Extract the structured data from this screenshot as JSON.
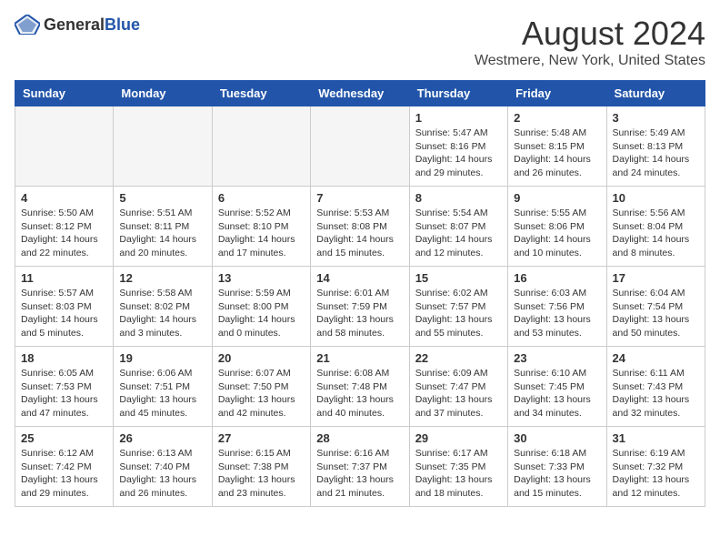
{
  "header": {
    "logo_general": "General",
    "logo_blue": "Blue",
    "month": "August 2024",
    "location": "Westmere, New York, United States"
  },
  "days_of_week": [
    "Sunday",
    "Monday",
    "Tuesday",
    "Wednesday",
    "Thursday",
    "Friday",
    "Saturday"
  ],
  "weeks": [
    [
      {
        "date": "",
        "info": ""
      },
      {
        "date": "",
        "info": ""
      },
      {
        "date": "",
        "info": ""
      },
      {
        "date": "",
        "info": ""
      },
      {
        "date": "1",
        "info": "Sunrise: 5:47 AM\nSunset: 8:16 PM\nDaylight: 14 hours\nand 29 minutes."
      },
      {
        "date": "2",
        "info": "Sunrise: 5:48 AM\nSunset: 8:15 PM\nDaylight: 14 hours\nand 26 minutes."
      },
      {
        "date": "3",
        "info": "Sunrise: 5:49 AM\nSunset: 8:13 PM\nDaylight: 14 hours\nand 24 minutes."
      }
    ],
    [
      {
        "date": "4",
        "info": "Sunrise: 5:50 AM\nSunset: 8:12 PM\nDaylight: 14 hours\nand 22 minutes."
      },
      {
        "date": "5",
        "info": "Sunrise: 5:51 AM\nSunset: 8:11 PM\nDaylight: 14 hours\nand 20 minutes."
      },
      {
        "date": "6",
        "info": "Sunrise: 5:52 AM\nSunset: 8:10 PM\nDaylight: 14 hours\nand 17 minutes."
      },
      {
        "date": "7",
        "info": "Sunrise: 5:53 AM\nSunset: 8:08 PM\nDaylight: 14 hours\nand 15 minutes."
      },
      {
        "date": "8",
        "info": "Sunrise: 5:54 AM\nSunset: 8:07 PM\nDaylight: 14 hours\nand 12 minutes."
      },
      {
        "date": "9",
        "info": "Sunrise: 5:55 AM\nSunset: 8:06 PM\nDaylight: 14 hours\nand 10 minutes."
      },
      {
        "date": "10",
        "info": "Sunrise: 5:56 AM\nSunset: 8:04 PM\nDaylight: 14 hours\nand 8 minutes."
      }
    ],
    [
      {
        "date": "11",
        "info": "Sunrise: 5:57 AM\nSunset: 8:03 PM\nDaylight: 14 hours\nand 5 minutes."
      },
      {
        "date": "12",
        "info": "Sunrise: 5:58 AM\nSunset: 8:02 PM\nDaylight: 14 hours\nand 3 minutes."
      },
      {
        "date": "13",
        "info": "Sunrise: 5:59 AM\nSunset: 8:00 PM\nDaylight: 14 hours\nand 0 minutes."
      },
      {
        "date": "14",
        "info": "Sunrise: 6:01 AM\nSunset: 7:59 PM\nDaylight: 13 hours\nand 58 minutes."
      },
      {
        "date": "15",
        "info": "Sunrise: 6:02 AM\nSunset: 7:57 PM\nDaylight: 13 hours\nand 55 minutes."
      },
      {
        "date": "16",
        "info": "Sunrise: 6:03 AM\nSunset: 7:56 PM\nDaylight: 13 hours\nand 53 minutes."
      },
      {
        "date": "17",
        "info": "Sunrise: 6:04 AM\nSunset: 7:54 PM\nDaylight: 13 hours\nand 50 minutes."
      }
    ],
    [
      {
        "date": "18",
        "info": "Sunrise: 6:05 AM\nSunset: 7:53 PM\nDaylight: 13 hours\nand 47 minutes."
      },
      {
        "date": "19",
        "info": "Sunrise: 6:06 AM\nSunset: 7:51 PM\nDaylight: 13 hours\nand 45 minutes."
      },
      {
        "date": "20",
        "info": "Sunrise: 6:07 AM\nSunset: 7:50 PM\nDaylight: 13 hours\nand 42 minutes."
      },
      {
        "date": "21",
        "info": "Sunrise: 6:08 AM\nSunset: 7:48 PM\nDaylight: 13 hours\nand 40 minutes."
      },
      {
        "date": "22",
        "info": "Sunrise: 6:09 AM\nSunset: 7:47 PM\nDaylight: 13 hours\nand 37 minutes."
      },
      {
        "date": "23",
        "info": "Sunrise: 6:10 AM\nSunset: 7:45 PM\nDaylight: 13 hours\nand 34 minutes."
      },
      {
        "date": "24",
        "info": "Sunrise: 6:11 AM\nSunset: 7:43 PM\nDaylight: 13 hours\nand 32 minutes."
      }
    ],
    [
      {
        "date": "25",
        "info": "Sunrise: 6:12 AM\nSunset: 7:42 PM\nDaylight: 13 hours\nand 29 minutes."
      },
      {
        "date": "26",
        "info": "Sunrise: 6:13 AM\nSunset: 7:40 PM\nDaylight: 13 hours\nand 26 minutes."
      },
      {
        "date": "27",
        "info": "Sunrise: 6:15 AM\nSunset: 7:38 PM\nDaylight: 13 hours\nand 23 minutes."
      },
      {
        "date": "28",
        "info": "Sunrise: 6:16 AM\nSunset: 7:37 PM\nDaylight: 13 hours\nand 21 minutes."
      },
      {
        "date": "29",
        "info": "Sunrise: 6:17 AM\nSunset: 7:35 PM\nDaylight: 13 hours\nand 18 minutes."
      },
      {
        "date": "30",
        "info": "Sunrise: 6:18 AM\nSunset: 7:33 PM\nDaylight: 13 hours\nand 15 minutes."
      },
      {
        "date": "31",
        "info": "Sunrise: 6:19 AM\nSunset: 7:32 PM\nDaylight: 13 hours\nand 12 minutes."
      }
    ]
  ]
}
